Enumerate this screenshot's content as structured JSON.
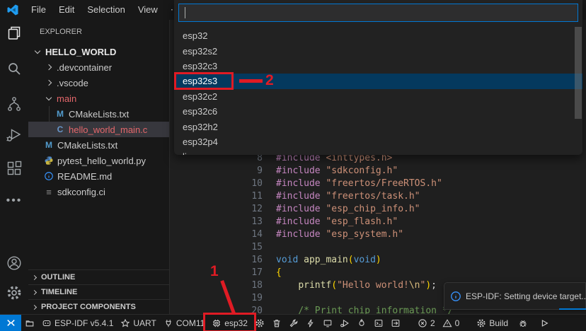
{
  "title_bar": {
    "menus": [
      {
        "label": "File"
      },
      {
        "label": "Edit"
      },
      {
        "label": "Selection"
      },
      {
        "label": "View"
      },
      {
        "label": "⋯"
      }
    ]
  },
  "activity_bar": {
    "top": [
      {
        "name": "explorer",
        "icon": "files",
        "active": true
      },
      {
        "name": "search",
        "icon": "search"
      },
      {
        "name": "source-control",
        "icon": "source-control"
      },
      {
        "name": "run-debug",
        "icon": "debug"
      },
      {
        "name": "extensions",
        "icon": "extensions"
      },
      {
        "name": "more-views",
        "icon": "ellipsis"
      }
    ],
    "bottom": [
      {
        "name": "account",
        "icon": "account"
      },
      {
        "name": "settings",
        "icon": "gear-large"
      }
    ]
  },
  "explorer": {
    "title": "EXPLORER",
    "tree": [
      {
        "label": "HELLO_WORLD",
        "kind": "folder-open",
        "indent": 0,
        "bold": true
      },
      {
        "label": ".devcontainer",
        "kind": "folder",
        "indent": 1
      },
      {
        "label": ".vscode",
        "kind": "folder",
        "indent": 1
      },
      {
        "label": "main",
        "kind": "folder-open",
        "indent": 1,
        "error": true
      },
      {
        "label": "CMakeLists.txt",
        "kind": "file",
        "icon": "cmake",
        "glyph": "M",
        "indent": 2
      },
      {
        "label": "hello_world_main.c",
        "kind": "file",
        "icon": "cfile",
        "glyph": "C",
        "indent": 2,
        "selected": true,
        "error": true
      },
      {
        "label": "CMakeLists.txt",
        "kind": "file",
        "icon": "cmake",
        "glyph": "M",
        "indent": 1
      },
      {
        "label": "pytest_hello_world.py",
        "kind": "file",
        "icon": "python",
        "indent": 1
      },
      {
        "label": "README.md",
        "kind": "file",
        "icon": "info",
        "indent": 1
      },
      {
        "label": "sdkconfig.ci",
        "kind": "file",
        "icon": "list",
        "glyph": "≡",
        "indent": 1
      }
    ],
    "sections": [
      {
        "label": "OUTLINE"
      },
      {
        "label": "TIMELINE"
      },
      {
        "label": "PROJECT COMPONENTS"
      }
    ]
  },
  "quick_pick": {
    "input_value": "",
    "selected_index": 3,
    "options": [
      {
        "label": "esp32"
      },
      {
        "label": "esp32s2"
      },
      {
        "label": "esp32c3"
      },
      {
        "label": "esp32s3"
      },
      {
        "label": "esp32c2"
      },
      {
        "label": "esp32c6"
      },
      {
        "label": "esp32h2"
      },
      {
        "label": "esp32p4"
      },
      {
        "label": "linux"
      }
    ]
  },
  "editor": {
    "lines": [
      {
        "num": "8",
        "tokens": [
          {
            "t": "#include",
            "c": "pp"
          },
          {
            "t": " ",
            "c": "pl"
          },
          {
            "t": "<inttypes.h>",
            "c": "str"
          }
        ]
      },
      {
        "num": "9",
        "tokens": [
          {
            "t": "#include",
            "c": "pp"
          },
          {
            "t": " ",
            "c": "pl"
          },
          {
            "t": "\"sdkconfig.h\"",
            "c": "str"
          }
        ]
      },
      {
        "num": "10",
        "tokens": [
          {
            "t": "#include",
            "c": "pp"
          },
          {
            "t": " ",
            "c": "pl"
          },
          {
            "t": "\"freertos/FreeRTOS.h\"",
            "c": "str"
          }
        ]
      },
      {
        "num": "11",
        "tokens": [
          {
            "t": "#include",
            "c": "pp"
          },
          {
            "t": " ",
            "c": "pl"
          },
          {
            "t": "\"freertos/task.h\"",
            "c": "str"
          }
        ]
      },
      {
        "num": "12",
        "tokens": [
          {
            "t": "#include",
            "c": "pp"
          },
          {
            "t": " ",
            "c": "pl"
          },
          {
            "t": "\"esp_chip_info.h\"",
            "c": "str"
          }
        ]
      },
      {
        "num": "13",
        "tokens": [
          {
            "t": "#include",
            "c": "pp"
          },
          {
            "t": " ",
            "c": "pl"
          },
          {
            "t": "\"esp_flash.h\"",
            "c": "str"
          }
        ]
      },
      {
        "num": "14",
        "tokens": [
          {
            "t": "#include",
            "c": "pp"
          },
          {
            "t": " ",
            "c": "pl"
          },
          {
            "t": "\"esp_system.h\"",
            "c": "str"
          }
        ]
      },
      {
        "num": "15",
        "tokens": []
      },
      {
        "num": "16",
        "tokens": [
          {
            "t": "void",
            "c": "kw"
          },
          {
            "t": " ",
            "c": "pl"
          },
          {
            "t": "app_main",
            "c": "fn"
          },
          {
            "t": "(",
            "c": "br"
          },
          {
            "t": "void",
            "c": "kw"
          },
          {
            "t": ")",
            "c": "br"
          }
        ]
      },
      {
        "num": "17",
        "tokens": [
          {
            "t": "{",
            "c": "br"
          }
        ]
      },
      {
        "num": "18",
        "tokens": [
          {
            "t": "    ",
            "c": "pl"
          },
          {
            "t": "printf",
            "c": "fn"
          },
          {
            "t": "(",
            "c": "br"
          },
          {
            "t": "\"Hello world!",
            "c": "str"
          },
          {
            "t": "\\n",
            "c": "esc"
          },
          {
            "t": "\"",
            "c": "str"
          },
          {
            "t": ")",
            "c": "br"
          },
          {
            "t": ";",
            "c": "pl"
          }
        ]
      },
      {
        "num": "19",
        "tokens": []
      },
      {
        "num": "20",
        "tokens": [
          {
            "t": "    ",
            "c": "pl"
          },
          {
            "t": "/* Print chip information */",
            "c": "cm"
          }
        ]
      }
    ]
  },
  "status_bar": {
    "items": [
      {
        "name": "remote-indicator",
        "icon": "remote",
        "remote": true
      },
      {
        "name": "esp-idf-explorer",
        "icon": "folder"
      },
      {
        "name": "esp-idf-version",
        "icon": "octoface",
        "label": "ESP-IDF v5.4.1"
      },
      {
        "name": "flash-method",
        "icon": "star",
        "label": "UART"
      },
      {
        "name": "serial-port",
        "icon": "plug",
        "label": "COM11"
      },
      {
        "name": "device-target",
        "icon": "chip",
        "label": "esp32",
        "annotated": true
      },
      {
        "name": "sdk-config-editor",
        "icon": "gear"
      },
      {
        "name": "full-clean",
        "icon": "trash"
      },
      {
        "name": "build-project",
        "icon": "wrench"
      },
      {
        "name": "flash-device",
        "icon": "flash"
      },
      {
        "name": "monitor-device",
        "icon": "monitor"
      },
      {
        "name": "debug-device",
        "icon": "debug-alt"
      },
      {
        "name": "build-flash-monitor",
        "icon": "flame"
      },
      {
        "name": "esp-idf-terminal",
        "icon": "terminal"
      },
      {
        "name": "custom-task",
        "icon": "export"
      },
      {
        "name": "problems-errors",
        "icon": "error",
        "label": "2",
        "gap": 14
      },
      {
        "name": "problems-warnings",
        "icon": "warning",
        "label": "0"
      },
      {
        "name": "build-status",
        "icon": "gear",
        "label": "Build",
        "gap": 14
      },
      {
        "name": "debug-status",
        "icon": "bug",
        "gap": 4
      },
      {
        "name": "run-status",
        "icon": "play",
        "gap": 6
      }
    ]
  },
  "notification": {
    "text": "ESP-IDF: Setting device target..."
  },
  "annotations": {
    "step1": "1",
    "step2": "2",
    "color": "#e01b24"
  },
  "colors": {
    "accent": "#0078d4",
    "quickpick_selected": "#04395e",
    "error_file": "#e4676b"
  }
}
